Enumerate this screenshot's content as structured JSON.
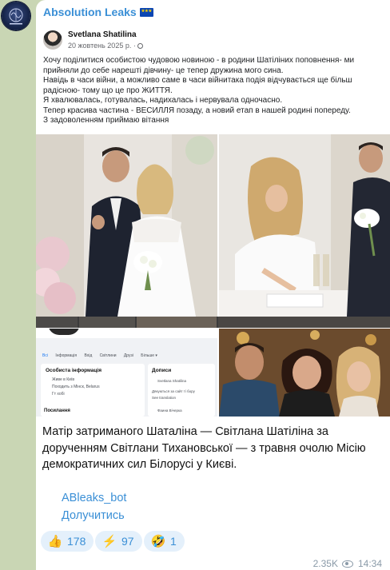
{
  "channel": {
    "title": "Absolution Leaks",
    "flag_icon": "eu-flag-icon",
    "avatar_icon": "brain-logo-icon"
  },
  "fb_post": {
    "author": "Svetlana Shatilina",
    "date": "20 жовтень 2025 р. ·",
    "lines": [
      "Хочу поділитися особистою чудовою новиною - в родини Шатіліних поповнення- ми",
      "прийняли до себе нарешті дівчину- це тепер дружина мого сина.",
      "Навідь в часи війни, а можливо саме в часи війнитака подія відчувається ще більш",
      "радісною- тому що це про ЖИТТЯ.",
      "Я хвалювалась, готувалась, надихалась і нервувала одночасно.",
      "Тепер красива частина - ВЕСИЛЛЯ позаду, а новий етап в нашей родині попереду.",
      "З задоволенням приймаю вітання"
    ]
  },
  "profile_shot": {
    "tabs": [
      "Всі",
      "Інформація",
      "Вхід",
      "Світлини",
      "Друзі",
      "Більше ▾"
    ],
    "section_title": "Особиста інформація",
    "rows": [
      "Живе в Київ",
      "Походить з Мінск, Belarus",
      "Гт хобі"
    ],
    "footer": "Посилання",
    "posts_title": "Дописи",
    "posts_author": "Svetlana Shatilina",
    "posts_text": "Дякуються за сайт ті бору",
    "posts_link": "See translation",
    "posts_author2": "Фаина Вічерка"
  },
  "caption": [
    "Матір затриманого Шаталіна — Світлана Шатіліна за",
    "дорученням Світлани Тихановської — з травня очолю Місію",
    "демократичних сил Білорусі у Києві."
  ],
  "links": {
    "bot": "ABleaks_bot",
    "subscribe": "Долучитись"
  },
  "reactions": [
    {
      "emoji": "👍",
      "icon": "thumbs-up-icon",
      "count": "178"
    },
    {
      "emoji": "⚡",
      "icon": "lightning-icon",
      "count": "97"
    },
    {
      "emoji": "🤣",
      "icon": "rofl-face-icon",
      "count": "1"
    }
  ],
  "meta": {
    "views": "2.35K",
    "time": "14:34",
    "eye_icon": "eye-icon"
  },
  "colors": {
    "accent": "#3a8fd6",
    "background": "#c9d6b4",
    "reaction_bg": "#e4f0fb"
  }
}
